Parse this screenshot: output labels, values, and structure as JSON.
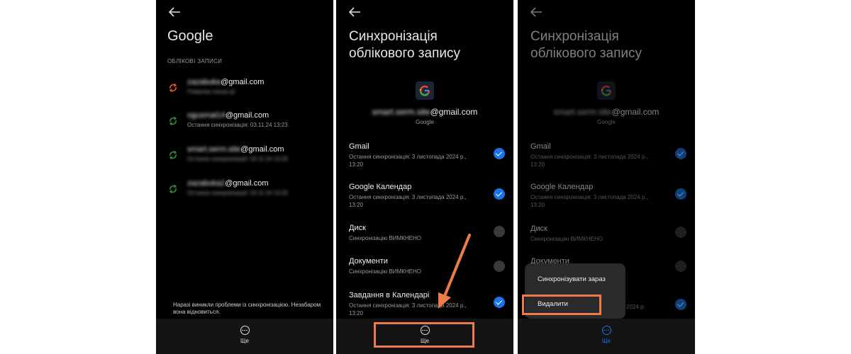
{
  "panel1": {
    "title": "Google",
    "section": "ОБЛІКОВІ ЗАПИСИ",
    "accounts": [
      {
        "email": "zazabuka@gmail.com",
        "status": "Помилка синхр-ції",
        "state": "error"
      },
      {
        "email": "ogusmal14@gmail.com",
        "status": "Остання синхронізація: 03.11.24 13:23",
        "state": "ok"
      },
      {
        "email": "smart.serm.site@gmail.com",
        "status": "Остання синхронізація: 03.11.24 13:23",
        "state": "ok"
      },
      {
        "email": "zazabuka2@gmail.com",
        "status": "Остання синхронізація: 03.11.24 13:23",
        "state": "ok"
      }
    ],
    "notice": "Наразі виникли проблеми із синхронізацією. Незабаром вона відновиться.",
    "more_label": "Ще"
  },
  "panel2": {
    "title_line1": "Синхронізація",
    "title_line2": "облікового запису",
    "account_email": "smart.serm.site@gmail.com",
    "account_type": "Google",
    "items": [
      {
        "name": "Gmail",
        "status": "Остання синхронізація: 3 листопада 2024 р., 13:20",
        "checked": true
      },
      {
        "name": "Google Календар",
        "status": "Остання синхронізація: 3 листопада 2024 р., 13:20",
        "checked": true
      },
      {
        "name": "Диск",
        "status": "Синхронізацію ВИМКНЕНО",
        "checked": false
      },
      {
        "name": "Документи",
        "status": "Синхронізацію ВИМКНЕНО",
        "checked": false
      },
      {
        "name": "Завдання в Календарі",
        "status": "Остання синхронізація: 3 листопада 2024 р., 13:20",
        "checked": true
      }
    ],
    "more_label": "Ще"
  },
  "panel3": {
    "title_line1": "Синхронізація",
    "title_line2": "облікового запису",
    "account_email": "smart.serm.site@gmail.com",
    "account_type": "Google",
    "items": [
      {
        "name": "Gmail",
        "status": "Остання синхронізація: 3 листопада 2024 р., 13:20"
      },
      {
        "name": "Google Календар",
        "status": "Остання синхронізація: 3 листопада 2024 р., 13:20"
      },
      {
        "name": "Диск",
        "status": "Синхронізацію ВИМКНЕНО"
      },
      {
        "name": "Документи"
      },
      {
        "status": "2024 р."
      }
    ],
    "menu": {
      "sync_now": "Синхронізувати зараз",
      "delete": "Видалити"
    },
    "more_label": "Ще"
  },
  "colors": {
    "accent": "#1a73e8",
    "highlight": "#ee7c4a",
    "error": "#e8542f",
    "ok": "#2e8b3a",
    "more_active": "#1a73e8"
  },
  "icons": [
    "back-arrow-icon",
    "sync-error-icon",
    "sync-icon",
    "google-logo-icon",
    "checkbox-icon",
    "more-icon"
  ]
}
